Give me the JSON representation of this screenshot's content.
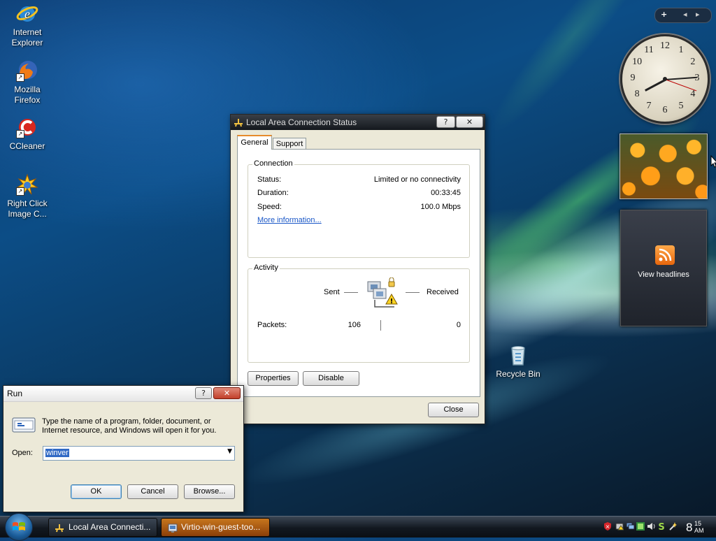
{
  "desktop": {
    "icons": [
      {
        "label_line1": "Internet",
        "label_line2": "Explorer",
        "icon": "internet-explorer-icon"
      },
      {
        "label_line1": "Mozilla",
        "label_line2": "Firefox",
        "icon": "firefox-icon"
      },
      {
        "label_line1": "CCleaner",
        "label_line2": "",
        "icon": "ccleaner-icon"
      },
      {
        "label_line1": "Right Click",
        "label_line2": "Image C...",
        "icon": "right-click-image-converter-icon"
      },
      {
        "label_line1": "Recycle Bin",
        "label_line2": "",
        "icon": "recycle-bin-icon"
      }
    ]
  },
  "sidebar": {
    "add_symbol": "+",
    "prev_symbol": "◂",
    "next_symbol": "▸",
    "clock_numbers": [
      "12",
      "1",
      "2",
      "3",
      "4",
      "5",
      "6",
      "7",
      "8",
      "9",
      "10",
      "11"
    ],
    "feeds_label": "View headlines"
  },
  "status_dialog": {
    "title": "Local Area Connection Status",
    "help_symbol": "?",
    "close_symbol": "✕",
    "tabs": [
      "General",
      "Support"
    ],
    "active_tab": "General",
    "connection": {
      "group_label": "Connection",
      "rows": [
        {
          "label": "Status:",
          "value": "Limited or no connectivity"
        },
        {
          "label": "Duration:",
          "value": "00:33:45"
        },
        {
          "label": "Speed:",
          "value": "100.0 Mbps"
        }
      ],
      "more_info": "More information..."
    },
    "activity": {
      "group_label": "Activity",
      "sent_label": "Sent",
      "received_label": "Received",
      "packets_label": "Packets:",
      "packets_sent": "106",
      "packets_received": "0"
    },
    "properties_label": "Properties",
    "disable_label": "Disable",
    "close_label": "Close"
  },
  "run_dialog": {
    "title": "Run",
    "help_symbol": "?",
    "close_symbol": "✕",
    "description_line1": "Type the name of a program, folder, document, or",
    "description_line2": "Internet resource, and Windows will open it for you.",
    "open_label": "Open:",
    "open_value": "winver",
    "ok_label": "OK",
    "cancel_label": "Cancel",
    "browse_label": "Browse..."
  },
  "taskbar": {
    "tasks": [
      {
        "label": "Local Area Connecti...",
        "active": false
      },
      {
        "label": "Virtio-win-guest-too...",
        "active": true
      }
    ],
    "clock_hour": "8",
    "clock_minutes": "15",
    "clock_ampm": "AM"
  }
}
